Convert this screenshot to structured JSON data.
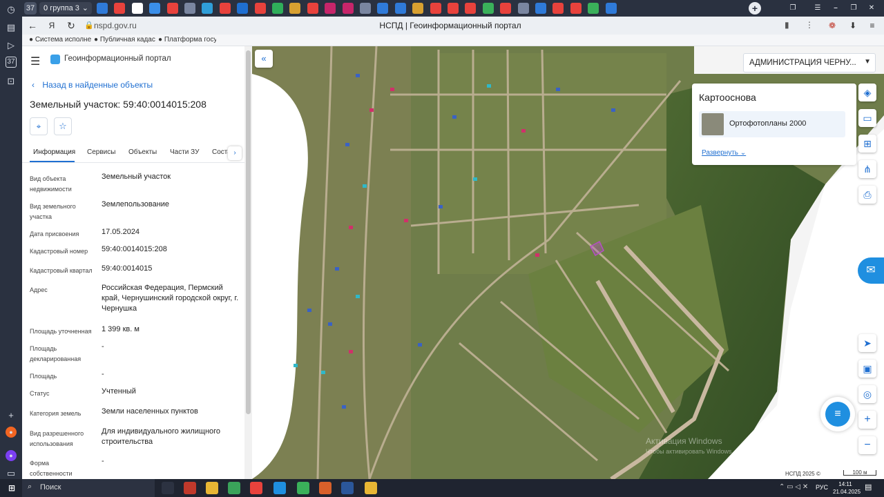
{
  "browser": {
    "tab_count": "37",
    "group_label": "группа 3",
    "url": "nspd.gov.ru",
    "page_title": "НСПД | Геоинформационный портал"
  },
  "bookmarks": [
    "Система исполне",
    "Публичная кадас",
    "Платформа госуд"
  ],
  "portal": {
    "title": "Геоинформационный портал",
    "back_link": "Назад в найденные объекты",
    "object_title": "Земельный участок: 59:40:0014015:208",
    "tabs": [
      "Информация",
      "Сервисы",
      "Объекты",
      "Части ЗУ",
      "Соста"
    ],
    "rows": [
      {
        "label": "Вид объекта недвижимости",
        "value": "Земельный участок"
      },
      {
        "label": "Вид земельного участка",
        "value": "Землепользование"
      },
      {
        "label": "Дата присвоения",
        "value": "17.05.2024"
      },
      {
        "label": "Кадастровый номер",
        "value": "59:40:0014015:208"
      },
      {
        "label": "Кадастровый квартал",
        "value": "59:40:0014015"
      },
      {
        "label": "Адрес",
        "value": "Российская Федерация, Пермский край, Чернушинский городской округ, г. Чернушка"
      },
      {
        "label": "Площадь уточненная",
        "value": "1 399 кв. м"
      },
      {
        "label": "Площадь декларированная",
        "value": "-"
      },
      {
        "label": "Площадь",
        "value": "-"
      },
      {
        "label": "Статус",
        "value": "Учтенный"
      },
      {
        "label": "Категория земель",
        "value": "Земли населенных пунктов"
      },
      {
        "label": "Вид разрешенного использования",
        "value": "Для индивидуального жилищного строительства"
      },
      {
        "label": "Форма собственности",
        "value": "-"
      }
    ]
  },
  "map": {
    "admin_select": "АДМИНИСТРАЦИЯ ЧЕРНУ...",
    "basemap_title": "Картооснова",
    "basemap_layer": "Ортофотопланы 2000",
    "expand_link": "Развернуть",
    "watermark_1": "Активация Windows",
    "watermark_2": "Чтобы активировать Windows, перейдите в раздел \"Параметры\".",
    "copyright": "НСПД 2025 ©",
    "scale": "100 м"
  },
  "taskbar": {
    "search": "Поиск",
    "lang": "РУС",
    "time": "14:11",
    "date": "21.04.2025"
  }
}
